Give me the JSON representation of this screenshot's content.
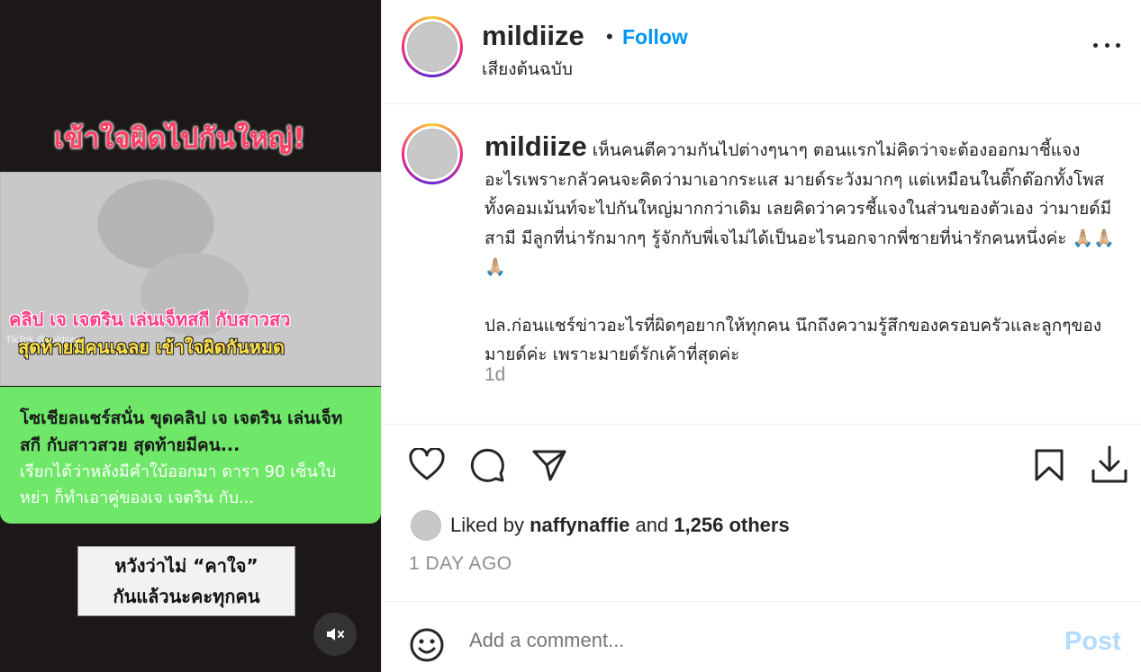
{
  "video": {
    "headline": "เข้าใจผิดไปกันใหญ่!",
    "thumb_caption_line1": "คลิป เจ เจตริน เล่นเจ็ทสกี กับสาวสว",
    "thumb_caption_line2": "สุดท้ายมีคนเฉลย เข้าใจผิดกันหมด",
    "tiktok_mark": "TikTok @mildiize",
    "news_title": "โซเชียลแชร์สนั่น ขุดคลิป เจ เจตริน เล่นเจ็ทสกี กับสาวสวย สุดท้ายมีคน...",
    "news_body": "เรียกได้ว่าหลังมีคำใบ้ออกมา ดารา 90 เซ็นใบหย่า ก็ทำเอาคู่ของเจ เจตริน กับ...",
    "subtitle_line1": "หวังว่าไม่ “คาใจ”",
    "subtitle_line2": "กันแล้วนะคะทุกคน",
    "mute_icon": "speaker-muted-icon"
  },
  "header": {
    "username": "mildiize",
    "separator": "•",
    "follow_label": "Follow",
    "audio": "เสียงต้นฉบับ",
    "more_icon": "more-horizontal-icon"
  },
  "caption": {
    "username": "mildiize",
    "paragraph1": "เห็นคนตีความกันไปต่างๆนาๆ ตอนแรกไม่คิดว่าจะต้องออกมาชี้แจงอะไรเพราะกลัวคนจะคิดว่ามาเอากระแส มายด์ระวังมากๆ แต่เหมือนในติ๊กต๊อกทั้งโพส ทั้งคอมเม้นท์จะไปกันใหญ่มากกว่าเดิม เลยคิดว่าควรชี้แจงในส่วนของตัวเอง ว่ามายด์มีสามี มีลูกที่น่ารักมากๆ รู้จักกับพี่เจไม่ได้เป็นอะไรนอกจากพี่ชายที่น่ารักคนหนึ่งค่ะ 🙏🏼🙏🏼🙏🏼",
    "paragraph2": "ปล.ก่อนแชร์ข่าวอะไรที่ผิดๆอยากให้ทุกคน นึกถึงความรู้สึกของครอบครัวและลูกๆของมายด์ค่ะ เพราะมายด์รักเค้าที่สุดค่ะ",
    "time": "1d"
  },
  "actions": {
    "like_icon": "heart-icon",
    "comment_icon": "comment-icon",
    "share_icon": "send-icon",
    "save_icon": "bookmark-icon",
    "download_icon": "download-icon"
  },
  "likes": {
    "prefix": "Liked by",
    "user": "naffynaffie",
    "conj": "and",
    "count": "1,256 others"
  },
  "date": "1 DAY AGO",
  "comment": {
    "emoji_icon": "emoji-icon",
    "placeholder": "Add a comment...",
    "post_label": "Post"
  },
  "colors": {
    "follow": "#0095f6",
    "post_disabled": "#b3dbff",
    "muted_text": "#8e8e8e",
    "headline_pink": "#ff3d63",
    "news_green": "#6fe86a"
  }
}
